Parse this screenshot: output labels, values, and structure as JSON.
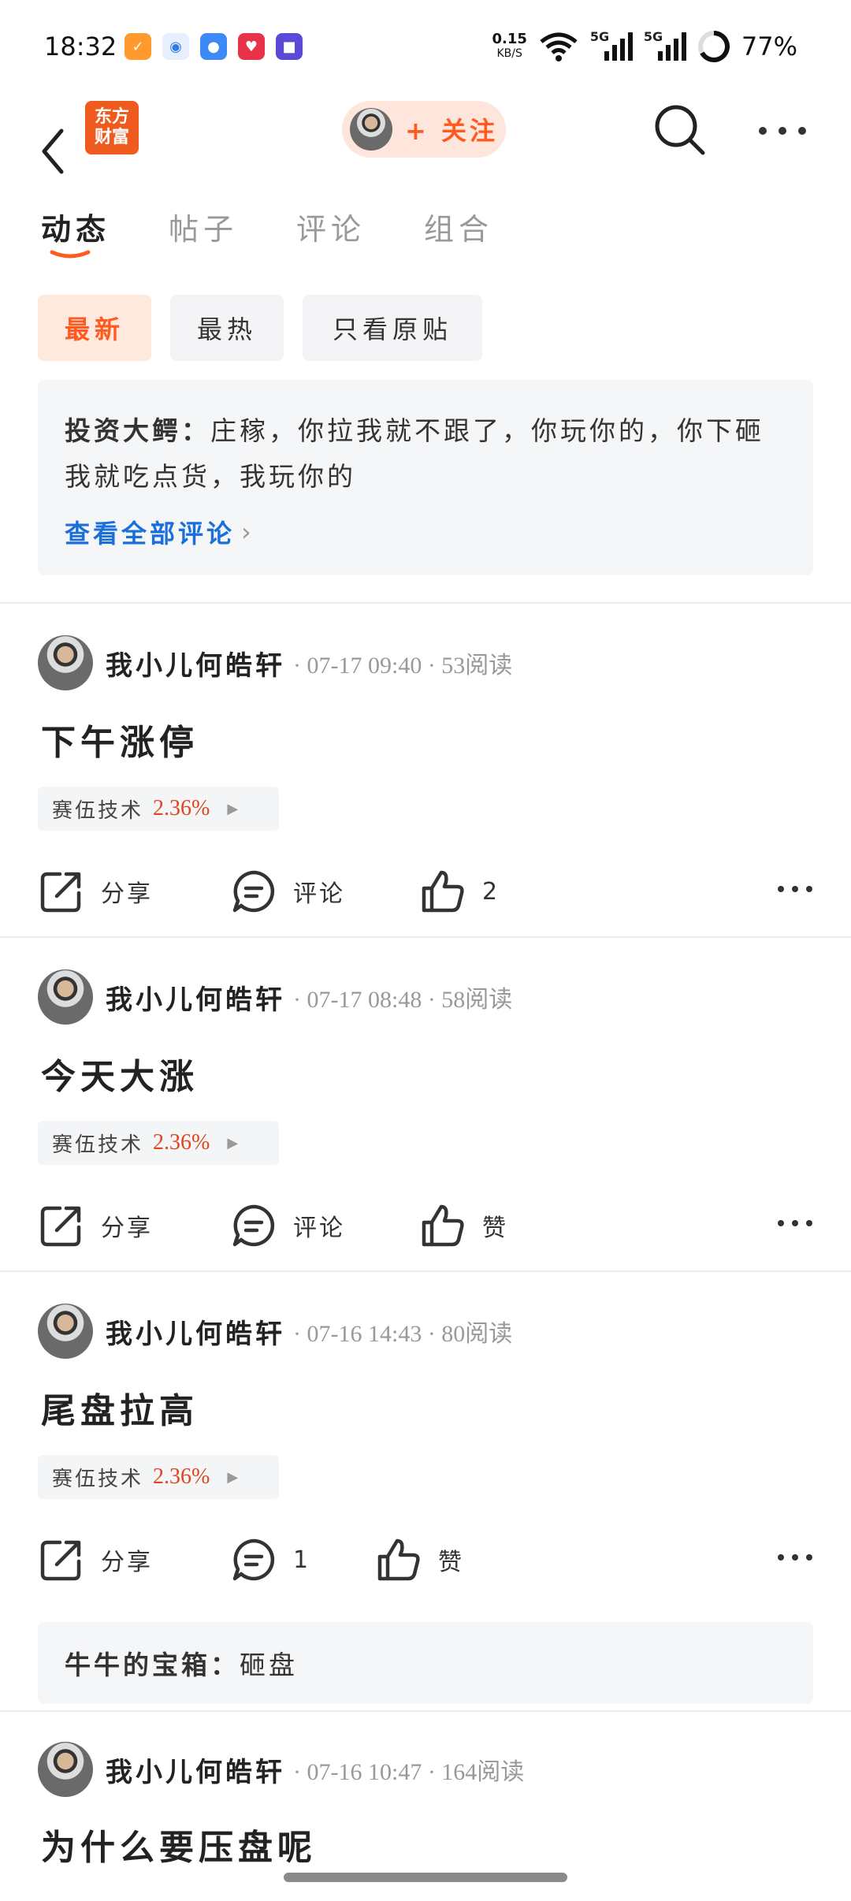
{
  "status_bar": {
    "time": "18:32",
    "net_speed_value": "0.15",
    "net_speed_unit": "KB/S",
    "signal_1_label": "5G",
    "signal_2_label": "5G",
    "battery": "77%"
  },
  "header": {
    "logo_line1": "东方",
    "logo_line2": "财富",
    "follow_label": "+ 关注"
  },
  "tabs": [
    "动态",
    "帖子",
    "评论",
    "组合"
  ],
  "chips": [
    "最新",
    "最热",
    "只看原贴"
  ],
  "pinned_comment": {
    "user": "投资大鳄：",
    "text": "庄稼，你拉我就不跟了，你玩你的，你下砸我就吃点货，我玩你的",
    "view_all": "查看全部评论"
  },
  "posts": [
    {
      "author": "我小儿何皓轩",
      "meta": "· 07-17 09:40 · 53阅读",
      "title": "下午涨停",
      "stock_name": "赛伍技术",
      "stock_pct": "2.36%",
      "share_label": "分享",
      "comment_label": "评论",
      "like_label": "2"
    },
    {
      "author": "我小儿何皓轩",
      "meta": "· 07-17 08:48 · 58阅读",
      "title": "今天大涨",
      "stock_name": "赛伍技术",
      "stock_pct": "2.36%",
      "share_label": "分享",
      "comment_label": "评论",
      "like_label": "赞"
    },
    {
      "author": "我小儿何皓轩",
      "meta": "· 07-16 14:43 · 80阅读",
      "title": "尾盘拉高",
      "stock_name": "赛伍技术",
      "stock_pct": "2.36%",
      "share_label": "分享",
      "comment_label": "1",
      "like_label": "赞",
      "reply_user": "牛牛的宝箱：",
      "reply_text": "砸盘"
    },
    {
      "author": "我小儿何皓轩",
      "meta": "· 07-16 10:47 · 164阅读",
      "title": "为什么要压盘呢"
    }
  ],
  "colors": {
    "accent": "#ff5a1f",
    "link": "#1a6fd8",
    "up": "#e0451d"
  }
}
